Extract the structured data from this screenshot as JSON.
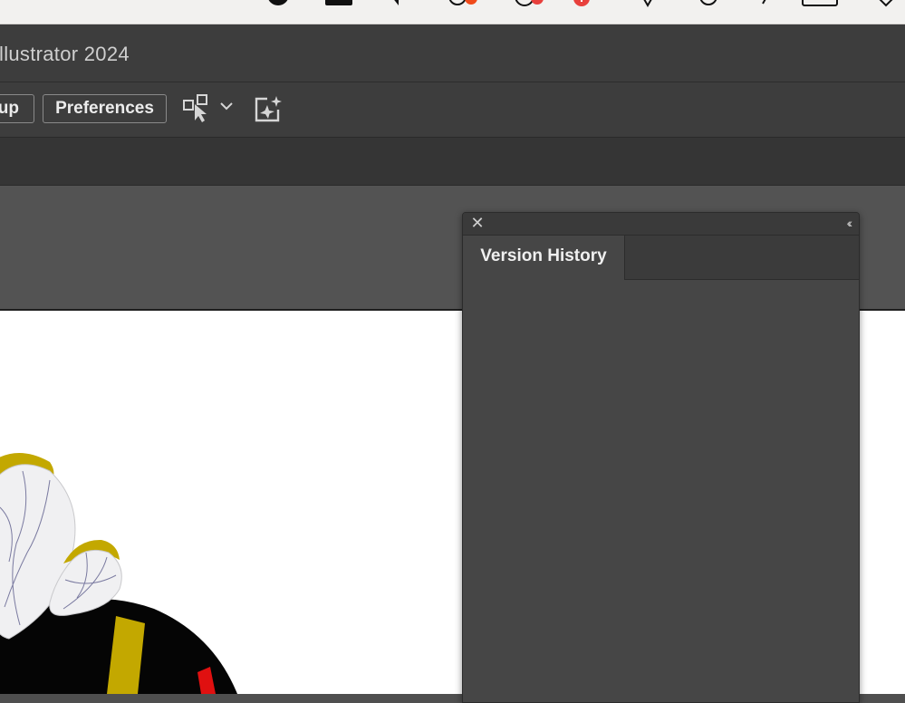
{
  "window": {
    "title": "llustrator 2024"
  },
  "toolbar": {
    "setup_label": "up",
    "preferences_label": "Preferences"
  },
  "panel": {
    "tab_label": "Version History",
    "close_symbol": "✕",
    "collapse_symbol": "‹‹"
  },
  "colors": {
    "chrome_dark": "#3d3d3d",
    "workspace": "#535353",
    "panel_bg": "#464646",
    "artboard": "#ffffff",
    "art_yellow": "#c3a800",
    "art_red": "#e01010"
  },
  "menubar_icons": [
    "status-icon",
    "app-badge-icon",
    "volume-icon",
    "recording-icon",
    "notification-icon",
    "alert-icon",
    "pen-icon",
    "clock-icon",
    "arrow-icon",
    "display-icon",
    "chevron-icon"
  ]
}
